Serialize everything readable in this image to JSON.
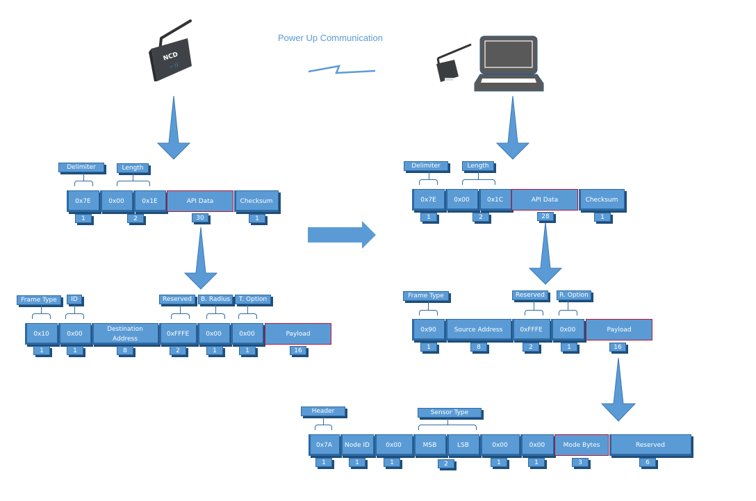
{
  "title": "Power Up Communication",
  "devices": {
    "sensor": "ncd-wireless-sensor",
    "gateway": "usb-modem-with-antenna",
    "computer": "laptop"
  },
  "colors": {
    "cell": "#5b9bd5",
    "border": "#2e6aa3",
    "highlight": "#c0152f",
    "title": "#5b9bd5"
  },
  "tx_frame": {
    "cells": [
      "0x7E",
      "0x00",
      "0x1E",
      "API Data",
      "Checksum"
    ],
    "labels": [
      "Delimiter",
      "Length"
    ],
    "counts": [
      "1",
      "2",
      "30",
      "1"
    ]
  },
  "tx_api": {
    "cells": [
      "0x10",
      "0x00",
      "Destination Address",
      "0xFFFE",
      "0x00",
      "0x00",
      "Payload"
    ],
    "labels": [
      "Frame Type",
      "ID",
      "Reserved",
      "B. Radius",
      "T. Option"
    ],
    "counts": [
      "1",
      "1",
      "8",
      "2",
      "1",
      "1",
      "16"
    ]
  },
  "rx_frame": {
    "cells": [
      "0x7E",
      "0x00",
      "0x1C",
      "API Data",
      "Checksum"
    ],
    "labels": [
      "Delimiter",
      "Length"
    ],
    "counts": [
      "1",
      "2",
      "28",
      "1"
    ]
  },
  "rx_api": {
    "cells": [
      "0x90",
      "Source Address",
      "0xFFFE",
      "0x00",
      "Payload"
    ],
    "labels": [
      "Frame Type",
      "Reserved",
      "R. Option"
    ],
    "counts": [
      "1",
      "8",
      "2",
      "1",
      "16"
    ]
  },
  "payload": {
    "cells": [
      "0x7A",
      "Node ID",
      "0x00",
      "MSB",
      "LSB",
      "0x00",
      "0x00",
      "Mode Bytes",
      "Reserved"
    ],
    "labels": [
      "Header",
      "Sensor Type"
    ],
    "counts": [
      "1",
      "1",
      "1",
      "2",
      "1",
      "1",
      "3",
      "6"
    ]
  }
}
